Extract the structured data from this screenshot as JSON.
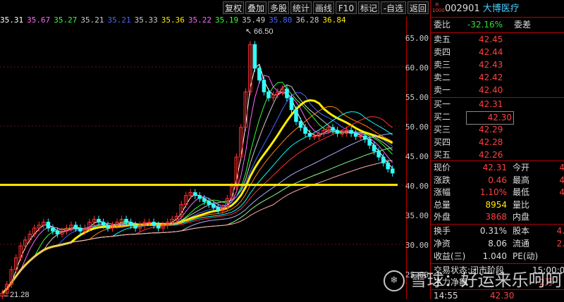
{
  "toolbar": {
    "buttons": [
      "复权",
      "叠加",
      "多股",
      "统计",
      "画线",
      "F10",
      "标记",
      "-自选",
      "返回"
    ]
  },
  "ma_values": [
    {
      "text": "35.31",
      "color": "#ffffff"
    },
    {
      "text": "35.67",
      "color": "#ff66ff"
    },
    {
      "text": "35.27",
      "color": "#33ff33"
    },
    {
      "text": "35.21",
      "color": "#cccccc"
    },
    {
      "text": "35.21",
      "color": "#4466ff"
    },
    {
      "text": "35.33",
      "color": "#cccccc"
    },
    {
      "text": "35.36",
      "color": "#ffee00"
    },
    {
      "text": "35.22",
      "color": "#ff66ff"
    },
    {
      "text": "35.19",
      "color": "#33ff33"
    },
    {
      "text": "35.49",
      "color": "#cccccc"
    },
    {
      "text": "35.80",
      "color": "#4466ff"
    },
    {
      "text": "36.28",
      "color": "#cccccc"
    },
    {
      "text": "36.84",
      "color": "#ffee00"
    }
  ],
  "chart_annotations": {
    "high": "66.50",
    "low": "21.28"
  },
  "y_axis": {
    "ticks": [
      "65.00",
      "60.00",
      "55.00",
      "50.00",
      "45.00",
      "40.00",
      "35.00",
      "30.00",
      "25.00"
    ],
    "range": [
      21,
      67
    ]
  },
  "stock": {
    "code": "002901",
    "name": "大博医疗",
    "badge_top": "R",
    "badge_bottom": "1000"
  },
  "weibi": {
    "label": "委比",
    "value": "-32.16%",
    "label2": "委差"
  },
  "asks": [
    {
      "label": "卖五",
      "price": "42.45"
    },
    {
      "label": "卖四",
      "price": "42.44"
    },
    {
      "label": "卖三",
      "price": "42.43"
    },
    {
      "label": "卖二",
      "price": "42.42"
    },
    {
      "label": "卖一",
      "price": "42.40"
    }
  ],
  "bids": [
    {
      "label": "买一",
      "price": "42.31"
    },
    {
      "label": "买二",
      "price": "42.30"
    },
    {
      "label": "买三",
      "price": "42.29"
    },
    {
      "label": "买四",
      "price": "42.28"
    },
    {
      "label": "买五",
      "price": "42.26"
    }
  ],
  "quote": [
    {
      "l": "现价",
      "v": "42.31",
      "l2": "今开",
      "v2": "4"
    },
    {
      "l": "涨跌",
      "v": "0.46",
      "l2": "最高",
      "v2": "4"
    },
    {
      "l": "涨幅",
      "v": "1.10%",
      "l2": "最低",
      "v2": "4"
    },
    {
      "l": "总量",
      "v": "8954",
      "l2": "量比",
      "v2": ""
    },
    {
      "l": "外盘",
      "v": "3868",
      "l2": "内盘",
      "v2": ""
    }
  ],
  "stats": [
    {
      "l": "换手",
      "v": "0.31%",
      "l2": "股本",
      "v2": "4."
    },
    {
      "l": "净资",
      "v": "8.06",
      "l2": "流通",
      "v2": "2."
    },
    {
      "l": "收益(三)",
      "v": "1.040",
      "l2": "PE(动)",
      "v2": ""
    }
  ],
  "status": {
    "label": "交易状态:",
    "value": "闭市阶段",
    "time": "15:00:00"
  },
  "net_flow": {
    "label": "主力净额",
    "value": "2万"
  },
  "last_trade": {
    "time": "14:55",
    "price": "42.30"
  },
  "watermark": "雪球：好运来乐呵呵",
  "chart_data": {
    "type": "candlestick",
    "ylim": [
      21,
      67
    ],
    "reference_line": 40.3,
    "close": [
      22,
      23.5,
      26,
      28,
      30,
      31,
      32,
      33,
      33.5,
      34,
      33,
      32.5,
      32,
      32.5,
      33,
      33.5,
      33,
      32.5,
      33,
      34,
      34.5,
      34,
      33.5,
      33,
      33.5,
      34,
      34.5,
      34,
      33.5,
      33,
      33.5,
      34,
      34,
      33.5,
      33,
      33.5,
      34,
      34.5,
      35,
      37,
      38.5,
      39,
      38.5,
      38,
      37.5,
      37,
      36.5,
      36,
      36.5,
      38,
      40,
      45,
      50,
      56,
      64,
      60,
      58,
      56,
      55,
      55.5,
      56,
      56.5,
      55,
      53,
      51,
      50,
      49,
      48.5,
      48.5,
      49,
      49.5,
      50,
      49.5,
      49,
      49,
      49.5,
      49,
      48.5,
      48.5,
      48,
      47,
      46,
      45,
      44,
      43,
      42.3
    ]
  }
}
